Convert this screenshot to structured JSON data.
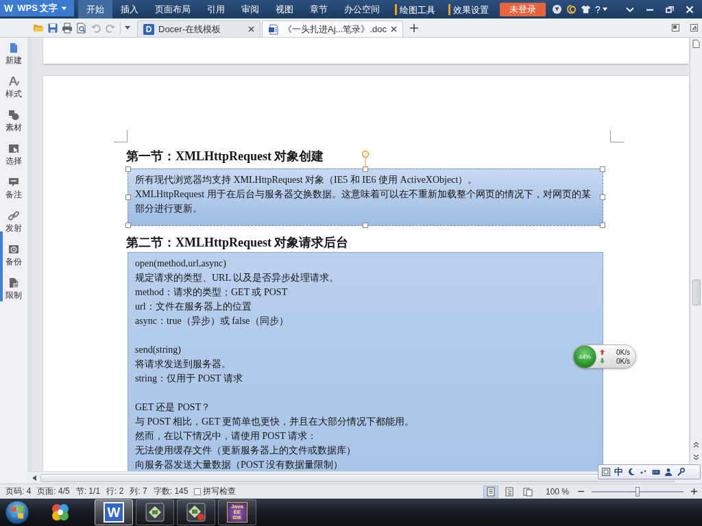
{
  "app_menu": {
    "logo": "W",
    "label": "WPS 文字"
  },
  "ribbon_tabs": [
    {
      "label": "开始",
      "selected": true,
      "kind": "main"
    },
    {
      "label": "插入",
      "selected": false,
      "kind": "main"
    },
    {
      "label": "页面布局",
      "selected": false,
      "kind": "main"
    },
    {
      "label": "引用",
      "selected": false,
      "kind": "main"
    },
    {
      "label": "审阅",
      "selected": false,
      "kind": "main"
    },
    {
      "label": "视图",
      "selected": false,
      "kind": "main"
    },
    {
      "label": "章节",
      "selected": false,
      "kind": "main"
    },
    {
      "label": "办公空间",
      "selected": false,
      "kind": "main"
    },
    {
      "label": "绘图工具",
      "selected": false,
      "kind": "context"
    },
    {
      "label": "效果设置",
      "selected": false,
      "kind": "context"
    }
  ],
  "login_button": {
    "label": "未登录"
  },
  "help_button": {
    "label": "?"
  },
  "quick_access": [
    {
      "disabled": false
    },
    {
      "disabled": false
    },
    {
      "disabled": false
    },
    {
      "disabled": false
    },
    {
      "disabled": true
    },
    {
      "disabled": true
    }
  ],
  "document_tabs": [
    {
      "kind": "docer",
      "logo": "D",
      "label": "Docer-在线模板",
      "selected": false
    },
    {
      "kind": "document",
      "label": "《一头扎进Aj...笔录》.doc",
      "selected": true
    }
  ],
  "sidebar": {
    "items": [
      {
        "label": "新建"
      },
      {
        "label": "样式"
      },
      {
        "label": "素材"
      },
      {
        "label": "选择"
      },
      {
        "label": "备注"
      },
      {
        "label": "发射"
      },
      {
        "label": "备份"
      },
      {
        "label": "限制"
      }
    ]
  },
  "document": {
    "sections": [
      {
        "heading": "第一节：XMLHttpRequest 对象创建",
        "selected": true,
        "paragraphs": [
          [
            "所有现代浏览器均支持 XMLHttpRequest 对象（IE5 和 IE6 使用 ActiveXObject）。",
            "XMLHttpRequest 用于在后台与服务器交换数据。这意味着可以在不重新加载整个网页的情况下，对网页的某部分进行更新。"
          ]
        ]
      },
      {
        "heading": "第二节：XMLHttpRequest 对象请求后台",
        "selected": false,
        "paragraphs": [
          [
            "open(method,url,async)",
            "规定请求的类型、URL 以及是否异步处理请求。",
            "method：请求的类型；GET 或 POST",
            "url：文件在服务器上的位置",
            "async：true（异步）或 false（同步）"
          ],
          [
            "send(string)",
            "将请求发送到服务器。",
            "string：仅用于 POST 请求"
          ],
          [
            "GET 还是 POST？",
            "与 POST 相比，GET 更简单也更快，并且在大部分情况下都能用。",
            "然而，在以下情况中，请使用 POST 请求：",
            "无法使用缓存文件（更新服务器上的文件或数据库）",
            "向服务器发送大量数据（POST 没有数据量限制）"
          ]
        ]
      }
    ]
  },
  "network_monitor": {
    "usage": "44%",
    "upload": "0K/s",
    "download": "0K/s"
  },
  "ime_bar": {
    "mode": "中"
  },
  "status_bar": {
    "fields": [
      "页码: 4",
      "页面: 4/5",
      "节: 1/1",
      "行: 2",
      "列: 7",
      "字数: 145"
    ],
    "spell_check": {
      "label": "拼写检查",
      "checked": false
    },
    "view_modes": [
      {
        "selected": true
      },
      {
        "selected": false
      },
      {
        "selected": false
      }
    ],
    "zoom": {
      "label": "100 %",
      "level": 0.5
    }
  },
  "taskbar": {
    "apps": [
      {
        "running": false,
        "selected": false
      },
      {
        "logo": "W",
        "running": true,
        "selected": true
      },
      {
        "running": true,
        "selected": false
      },
      {
        "running": true,
        "selected": false
      },
      {
        "logo": "Java EE IDE",
        "running": true,
        "selected": false
      }
    ]
  }
}
